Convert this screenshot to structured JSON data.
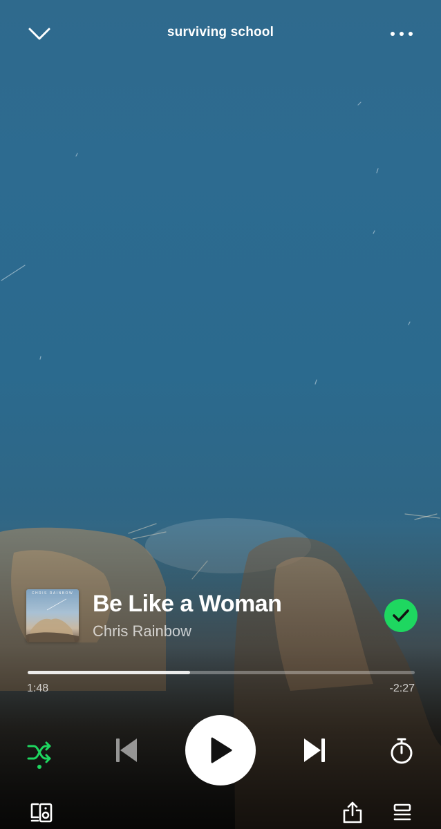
{
  "header": {
    "playlist_name": "surviving school"
  },
  "track": {
    "title": "Be Like a Woman",
    "artist": "Chris Rainbow",
    "cover_text": "CHRIS RAINBOW",
    "saved": true
  },
  "playback": {
    "elapsed": "1:48",
    "remaining": "-2:27",
    "progress_fraction": 0.42,
    "is_playing": false,
    "shuffle_on": true
  },
  "colors": {
    "accent": "#1ed760",
    "text": "#ffffff"
  },
  "icons": {
    "collapse": "chevron-down-icon",
    "more": "more-dots-icon",
    "saved": "check-icon",
    "shuffle": "shuffle-icon",
    "previous": "skip-previous-icon",
    "play": "play-icon",
    "next": "skip-next-icon",
    "timer": "sleep-timer-icon",
    "devices": "connect-device-icon",
    "share": "share-icon",
    "queue": "queue-icon"
  }
}
